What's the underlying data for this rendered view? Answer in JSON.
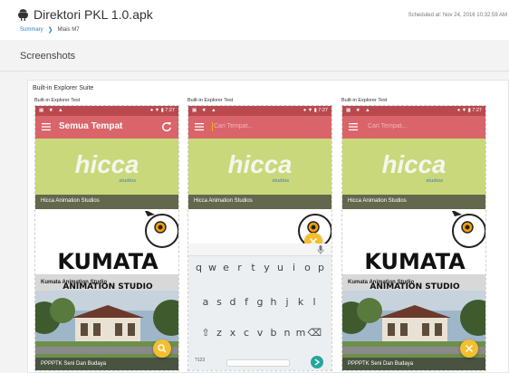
{
  "header": {
    "app_title": "Direktori PKL 1.0.apk",
    "scheduled": "Scheduled at: Nov 24, 2016 10:32:59 AM",
    "breadcrumb": {
      "link": "Summary",
      "current": "Mlais M7"
    }
  },
  "section": {
    "title": "Screenshots"
  },
  "suite": {
    "title": "Built-in Explorer Suite"
  },
  "phones": [
    {
      "label": "Built-in Explorer Test",
      "status_time": "7:27",
      "appbar_title": "Semua Tempat",
      "cards": [
        "Hicca Animation Studios",
        "Kumata Animation Studio",
        "PPPPTK Seni Dan Budaya"
      ]
    },
    {
      "label": "Built-in Explorer Test",
      "status_time": "7:27",
      "search_placeholder": "Cari Tempat...",
      "cards": [
        "Hicca Animation Studios"
      ],
      "keyboard": {
        "row1": [
          "q",
          "w",
          "e",
          "r",
          "t",
          "y",
          "u",
          "i",
          "o",
          "p"
        ],
        "row2": [
          "a",
          "s",
          "d",
          "f",
          "g",
          "h",
          "j",
          "k",
          "l"
        ],
        "row3": [
          "z",
          "x",
          "c",
          "v",
          "b",
          "n",
          "m"
        ],
        "num_key": "?123"
      }
    },
    {
      "label": "Built-in Explorer Test",
      "status_time": "7:27",
      "search_placeholder": "Cari Tempat...",
      "cards": [
        "Hicca Animation Studios",
        "Kumata Animation Studio",
        "PPPPTK Seni Dan Budaya"
      ]
    }
  ],
  "card_logos": {
    "hicca": "hicca",
    "hicca_sub": "studios",
    "kumata": "KUMATA",
    "kumata_sub": "ANIMATION STUDIO"
  },
  "colors": {
    "appbar": "#d9646a",
    "statusbar": "#b84a4f",
    "fab": "#f4bf2e",
    "link": "#2d83c4"
  },
  "icons": [
    "android-icon",
    "chevron-right-icon",
    "menu-icon",
    "refresh-icon",
    "search-icon",
    "close-icon",
    "mic-icon",
    "backspace-icon",
    "shift-icon",
    "enter-icon"
  ]
}
